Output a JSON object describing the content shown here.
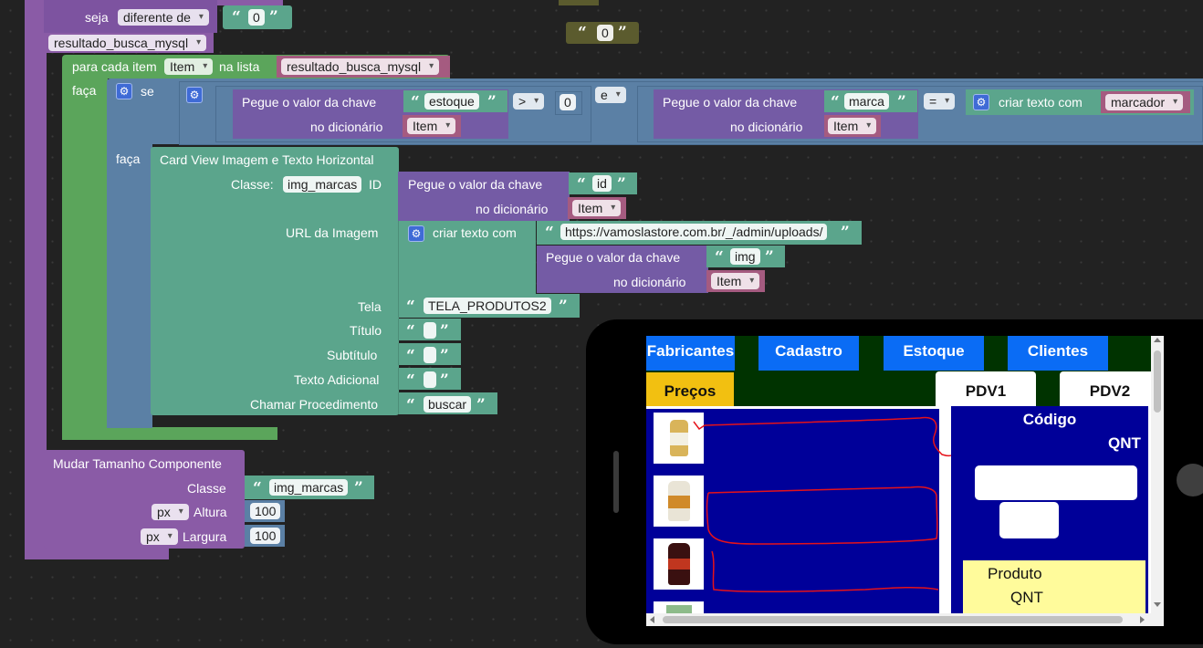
{
  "blocks": {
    "seja_label": "seja",
    "diferente_de": "diferente de",
    "quote_zero_top": "0",
    "result_var": "resultado_busca_mysql",
    "floating_zero": "0",
    "para_cada_item": "para cada item",
    "item_var": "Item",
    "na_lista": "na lista",
    "lista_var": "resultado_busca_mysql",
    "faca": "faça",
    "se": "se",
    "pegue_valor": "Pegue o valor da chave",
    "estoque_key": "estoque",
    "no_dicionario": "no dicionário",
    "op_gt": ">",
    "zero_value": "0",
    "e_op": "e",
    "marca_key": "marca",
    "op_eq": "=",
    "criar_texto_com": "criar texto com",
    "marcador_var": "marcador",
    "faca2": "faça",
    "card_view_title": "Card View Imagem e Texto Horizontal",
    "classe_label": "Classe:",
    "img_marcas": "img_marcas",
    "id_label": "ID",
    "id_key": "id",
    "url_imagem": "URL da Imagem",
    "url_value": "https://vamoslastore.com.br/_/admin/uploads/",
    "img_key": "img",
    "tela_label": "Tela",
    "tela_value": "TELA_PRODUTOS2",
    "titulo_label": "Título",
    "subtitulo_label": "Subtítulo",
    "texto_adicional_label": "Texto Adicional",
    "chamar_procedimento_label": "Chamar Procedimento",
    "buscar_value": "buscar",
    "mudar_tamanho": "Mudar Tamanho Componente",
    "classe2_label": "Classe",
    "img_marcas2": "img_marcas",
    "px1": "px",
    "altura_label": "Altura",
    "altura_value": "100",
    "px2": "px",
    "largura_label": "Largura",
    "largura_value": "100"
  },
  "phone": {
    "buttons": {
      "fabricantes": "Fabricantes",
      "cadastro": "Cadastro",
      "estoque": "Estoque",
      "clientes": "Clientes",
      "precos": "Preços"
    },
    "tabs": {
      "pdv1": "PDV1",
      "pdv2": "PDV2"
    },
    "codigo": "Código",
    "qnt": "QNT",
    "produto": "Produto",
    "produto_qnt": "QNT"
  },
  "colors": {
    "workspace": "#222222",
    "accent_blue": "#0a6cf5",
    "navy": "#000099",
    "dark_green": "#003300",
    "yellow": "#f2c011",
    "pale_yellow": "#fffb9b"
  }
}
